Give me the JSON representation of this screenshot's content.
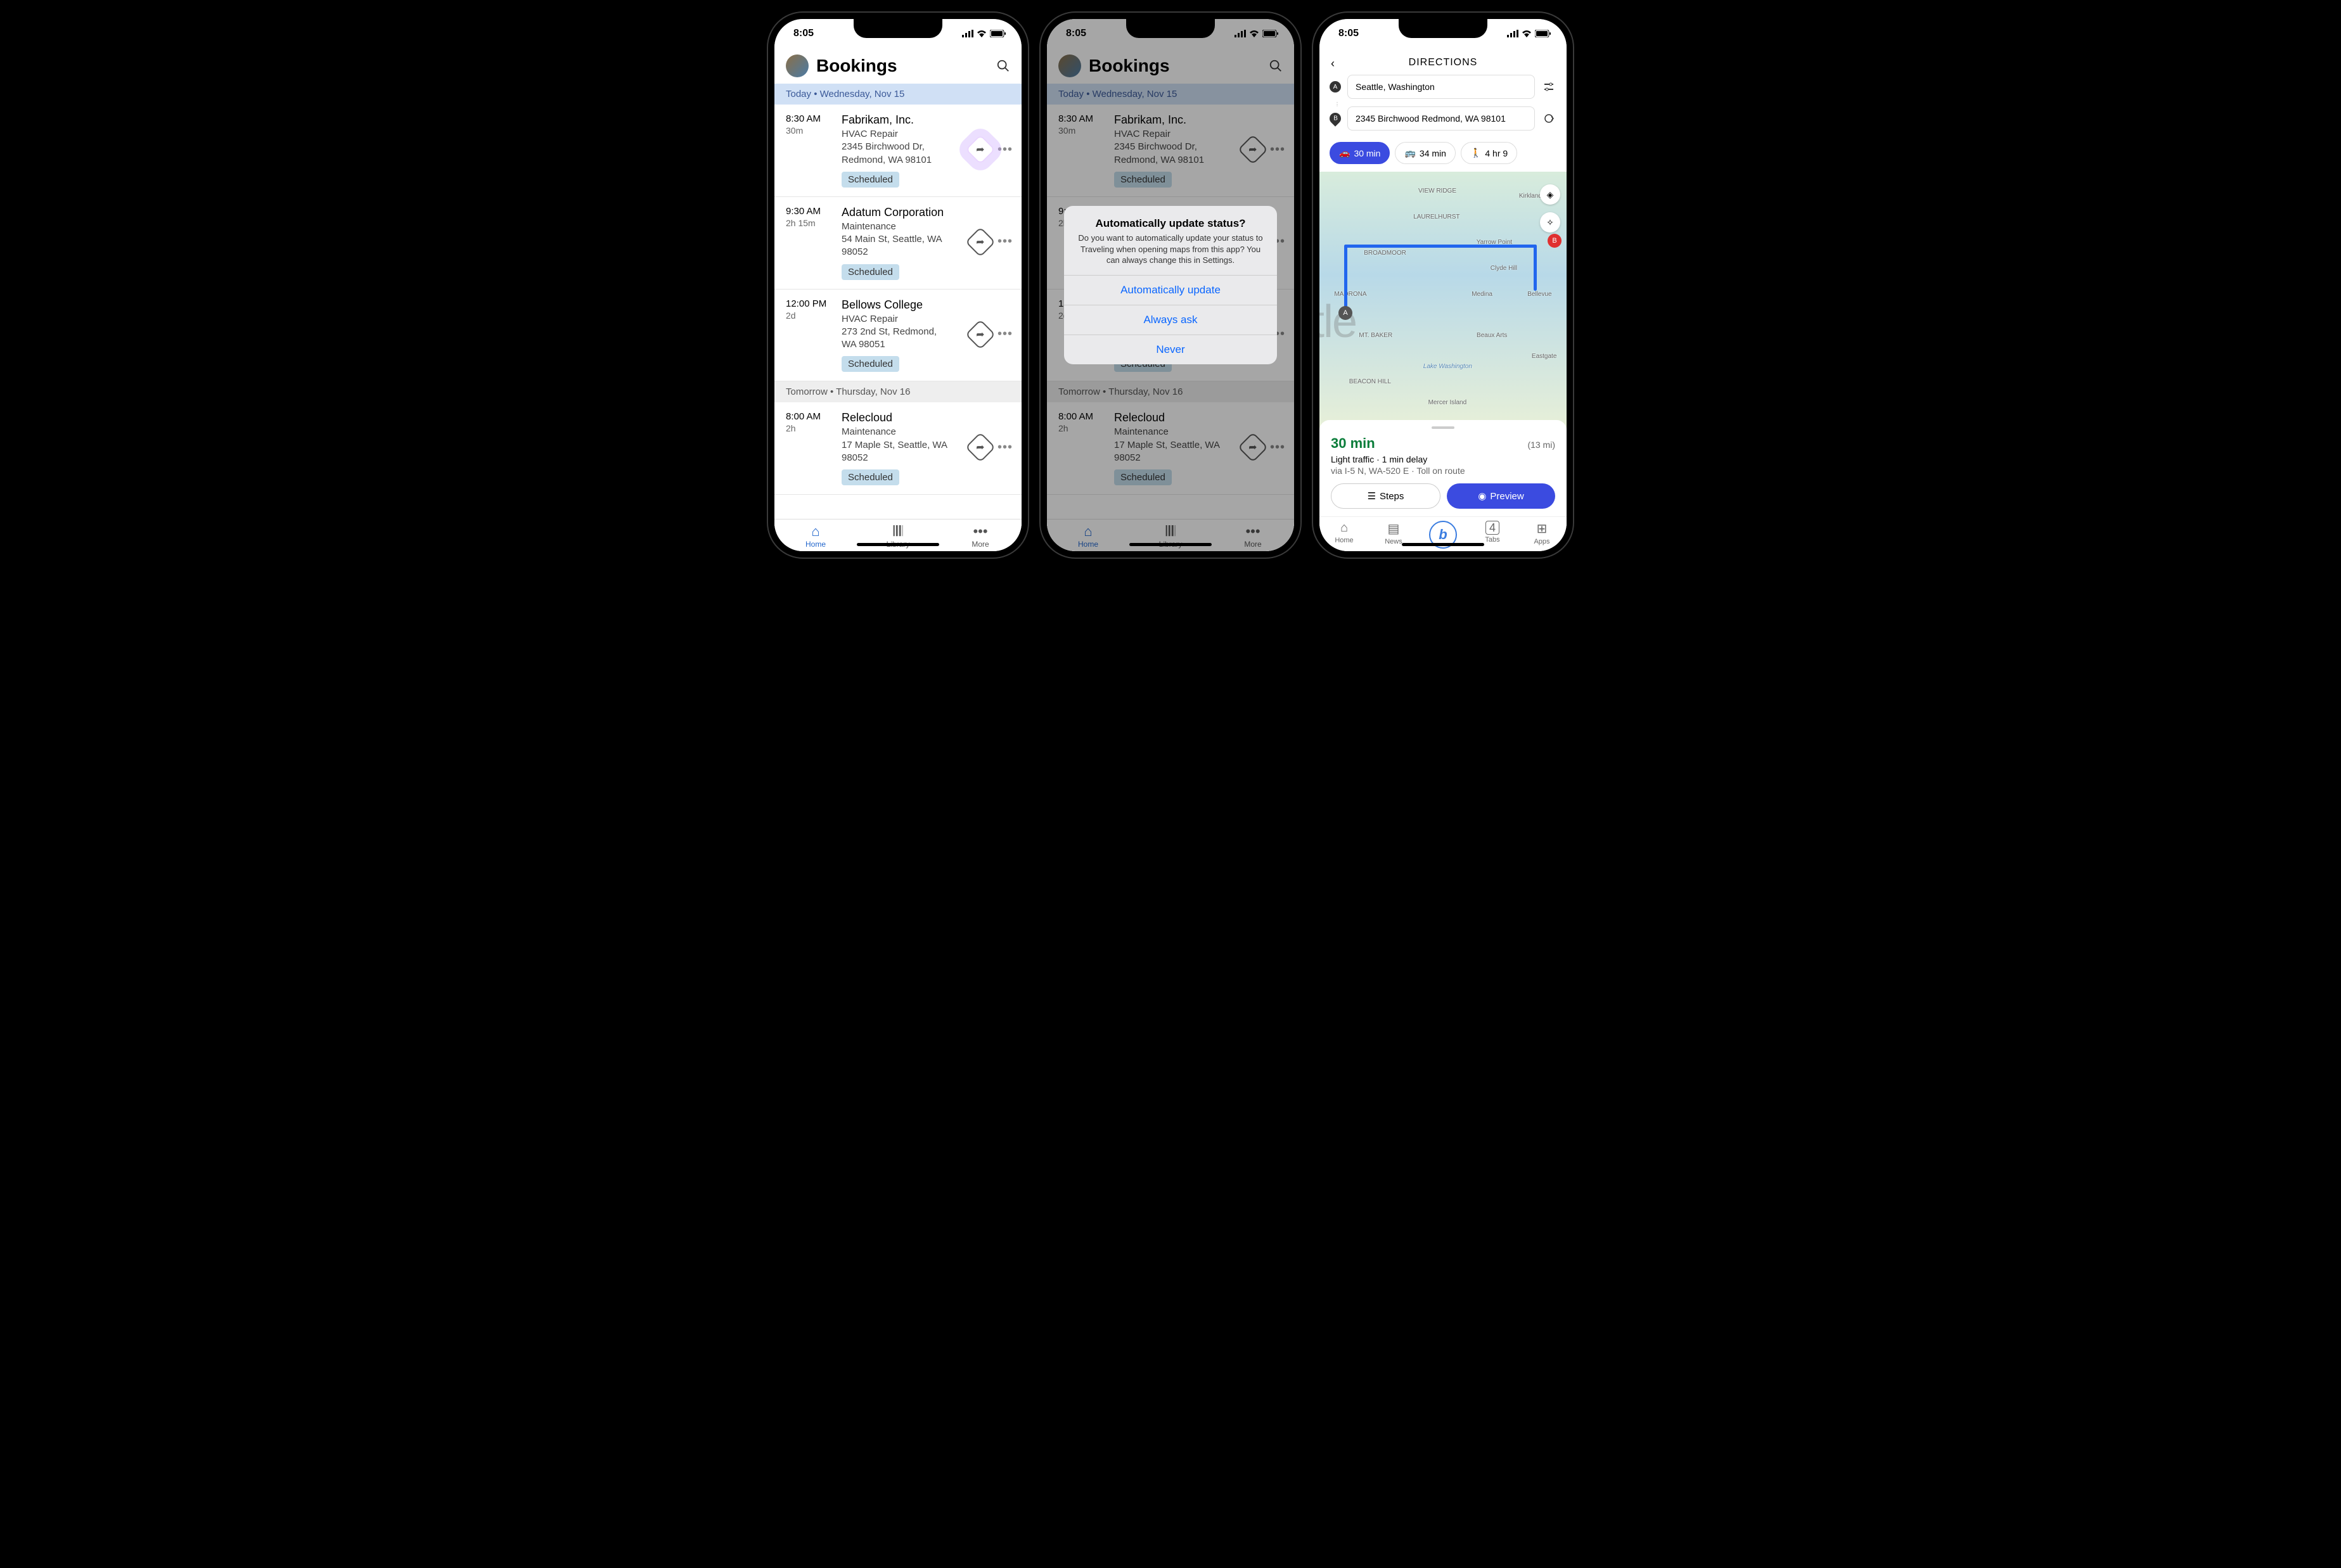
{
  "status": {
    "time": "8:05"
  },
  "bookings": {
    "title": "Bookings",
    "today_label": "Today  •  Wednesday, Nov 15",
    "tomorrow_label": "Tomorrow  •  Thursday, Nov 16",
    "items": [
      {
        "time": "8:30 AM",
        "dur": "30m",
        "name": "Fabrikam, Inc.",
        "service": "HVAC Repair",
        "addr1": "2345 Birchwood Dr,",
        "addr2": "Redmond, WA 98101",
        "status": "Scheduled"
      },
      {
        "time": "9:30 AM",
        "dur": "2h 15m",
        "name": "Adatum Corporation",
        "service": "Maintenance",
        "addr1": "54 Main St, Seattle, WA",
        "addr2": "98052",
        "status": "Scheduled"
      },
      {
        "time": "12:00 PM",
        "dur": "2d",
        "name": "Bellows College",
        "service": "HVAC Repair",
        "addr1": "273 2nd St, Redmond,",
        "addr2": "WA 98051",
        "status": "Scheduled"
      },
      {
        "time": "8:00 AM",
        "dur": "2h",
        "name": "Relecloud",
        "service": "Maintenance",
        "addr1": "17 Maple St, Seattle, WA",
        "addr2": "98052",
        "status": "Scheduled"
      }
    ],
    "nav": {
      "home": "Home",
      "library": "Library",
      "more": "More"
    }
  },
  "alert": {
    "title": "Automatically update status?",
    "msg": "Do you want to automatically update your status to Traveling when opening maps from this app? You can always change this in Settings.",
    "btn1": "Automatically update",
    "btn2": "Always ask",
    "btn3": "Never"
  },
  "directions": {
    "title": "DIRECTIONS",
    "from": "Seattle, Washington",
    "to": "2345 Birchwood Redmond, WA 98101",
    "modes": {
      "drive": "30 min",
      "transit": "34 min",
      "walk": "4 hr 9"
    },
    "result_time": "30 min",
    "result_dist": "(13 mi)",
    "traffic": "Light traffic · 1 min delay",
    "via": "via I-5 N, WA-520 E · Toll on route",
    "steps_btn": "Steps",
    "preview_btn": "Preview",
    "nav": {
      "home": "Home",
      "news": "News",
      "tabs": "Tabs",
      "apps": "Apps",
      "tabs_count": "4"
    },
    "map_labels": [
      "VIEW RIDGE",
      "Kirkland",
      "LAURELHURST",
      "Yarrow Point",
      "BROADMOOR",
      "Clyde Hill",
      "MADRONA",
      "Medina",
      "Bellevue",
      "MT. BAKER",
      "Beaux Arts",
      "Eastgate",
      "Lake Washington",
      "BEACON HILL",
      "Mercer Island"
    ]
  }
}
